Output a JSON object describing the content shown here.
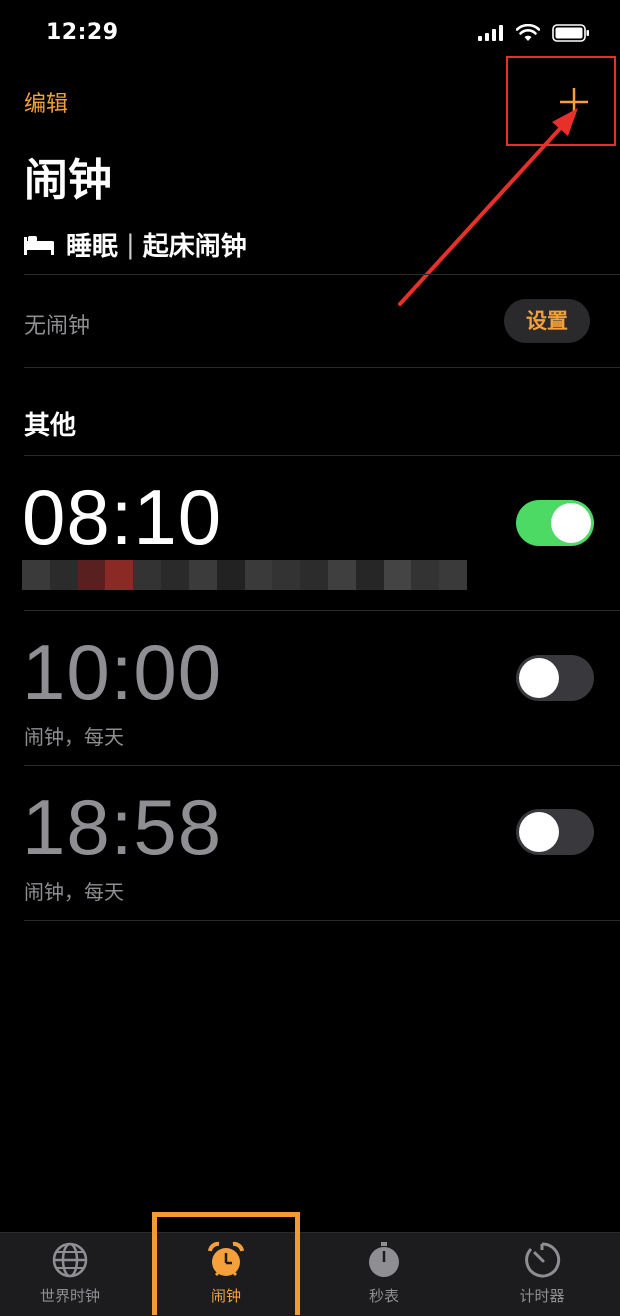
{
  "status_bar": {
    "time": "12:29"
  },
  "header": {
    "edit_label": "编辑",
    "add_label": "+",
    "title": "闹钟"
  },
  "sleep": {
    "title_left": "睡眠",
    "title_right": "起床闹钟",
    "separator": "|",
    "empty_text": "无闹钟",
    "set_label": "设置"
  },
  "other_section": {
    "title": "其他"
  },
  "alarms": [
    {
      "time": "08:10",
      "label": "",
      "enabled": true
    },
    {
      "time": "10:00",
      "label": "闹钟，每天",
      "enabled": false
    },
    {
      "time": "18:58",
      "label": "闹钟，每天",
      "enabled": false
    }
  ],
  "tabs": [
    {
      "label": "世界时钟",
      "icon": "globe-icon",
      "active": false
    },
    {
      "label": "闹钟",
      "icon": "alarm-clock-icon",
      "active": true
    },
    {
      "label": "秒表",
      "icon": "stopwatch-icon",
      "active": false
    },
    {
      "label": "计时器",
      "icon": "timer-icon",
      "active": false
    }
  ],
  "colors": {
    "accent": "#f5a03a",
    "toggle_on": "#4cd964",
    "annotation_red": "#e8302a",
    "annotation_orange": "#f39a33"
  }
}
